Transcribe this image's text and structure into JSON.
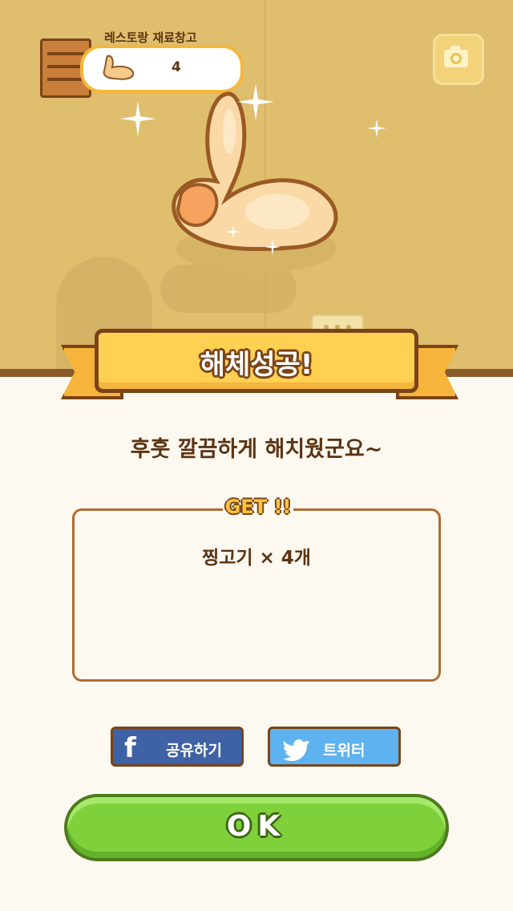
{
  "storage": {
    "label": "레스토랑 재료창고",
    "count": "4"
  },
  "result": {
    "title": "해체성공!",
    "message": "후훗 깔끔하게 해치웠군요~",
    "get_label": "GET !!",
    "reward": "찡고기 × 4개"
  },
  "share": {
    "facebook_label": "공유하기",
    "twitter_label": "트위터"
  },
  "ok_label": "OK",
  "colors": {
    "scene": "#dfbe6e",
    "banner": "#ffd052",
    "ok": "#7fd13b",
    "facebook": "#3f62a6",
    "twitter": "#5eb2ef"
  }
}
